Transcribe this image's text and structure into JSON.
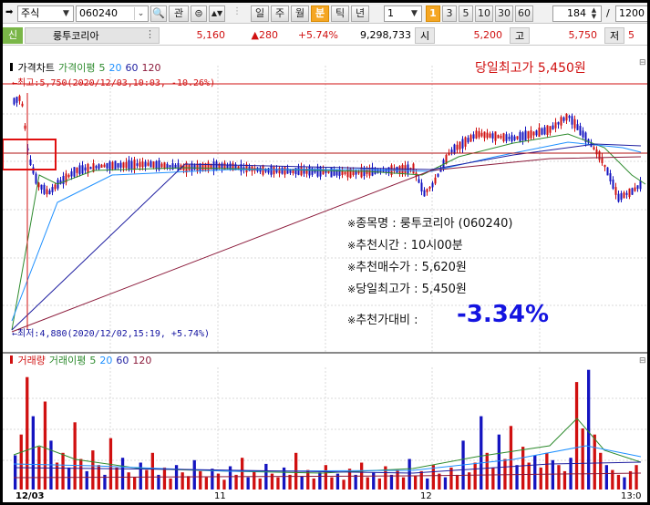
{
  "toolbar": {
    "market_label": "주식",
    "code_value": "060240",
    "search_label": "관",
    "period_buttons": [
      "일",
      "주",
      "월",
      "분",
      "틱",
      "년"
    ],
    "selected_period": "분",
    "interval_value": "1",
    "minute_buttons": [
      "1",
      "3",
      "5",
      "10",
      "30",
      "60"
    ],
    "selected_minute": "1",
    "count_value": "184",
    "slash": "/",
    "total_value": "1200"
  },
  "infobar": {
    "credit_badge": "신",
    "stock_name": "룽투코리아",
    "price": "5,160",
    "change": "▲280",
    "change_pct": "+5.74%",
    "volume": "9,298,733",
    "open_label": "시",
    "open_value": "5,200",
    "high_label": "고",
    "high_value": "5,750",
    "low_label": "저",
    "low_value": "5"
  },
  "price_chart": {
    "legend": [
      {
        "text": "가격차트",
        "color": "#000000"
      },
      {
        "text": "가격이평",
        "color": "#2e8b2e"
      },
      {
        "text": "5",
        "color": "#2e8b2e"
      },
      {
        "text": "20",
        "color": "#1e90ff"
      },
      {
        "text": "60",
        "color": "#1e1ea0"
      },
      {
        "text": "120",
        "color": "#8b1a3a"
      }
    ],
    "high_marker": "←최고:5,750(2020/12/03,10:03, -10.26%)",
    "low_marker": "←최저:4,880(2020/12/02,15:19, +5.74%)",
    "daily_high_banner": "당일최고가 5,450원",
    "bullet_mark": "※",
    "info_lines": [
      "종목명 : 룽투코리아 (060240)",
      "추천시간 : 10시00분",
      "추천매수가 : 5,620원",
      "당일최고가 : 5,450원",
      "추천가대비 :"
    ],
    "return_value": "-3.34%",
    "return_color": "#1414e0"
  },
  "volume_chart": {
    "legend": [
      {
        "text": "거래량",
        "color": "#d01010"
      },
      {
        "text": "거래이평",
        "color": "#2e8b2e"
      },
      {
        "text": "5",
        "color": "#2e8b2e"
      },
      {
        "text": "20",
        "color": "#1e90ff"
      },
      {
        "text": "60",
        "color": "#1e1ea0"
      },
      {
        "text": "120",
        "color": "#8b1a3a"
      }
    ]
  },
  "x_axis": {
    "labels": [
      "12/03",
      "11",
      "12",
      "13:0"
    ]
  },
  "chart_data": {
    "type": "candlestick",
    "price_high": 5750,
    "price_low": 4880,
    "volume_bars": [
      0.28,
      0.45,
      0.92,
      0.6,
      0.35,
      0.72,
      0.4,
      0.22,
      0.3,
      0.18,
      0.55,
      0.25,
      0.15,
      0.32,
      0.2,
      0.12,
      0.42,
      0.18,
      0.26,
      0.14,
      0.1,
      0.22,
      0.16,
      0.3,
      0.12,
      0.18,
      0.09,
      0.2,
      0.14,
      0.11,
      0.24,
      0.15,
      0.1,
      0.17,
      0.13,
      0.08,
      0.19,
      0.12,
      0.26,
      0.1,
      0.15,
      0.09,
      0.21,
      0.13,
      0.1,
      0.18,
      0.12,
      0.3,
      0.11,
      0.16,
      0.09,
      0.14,
      0.2,
      0.1,
      0.13,
      0.08,
      0.17,
      0.12,
      0.22,
      0.1,
      0.14,
      0.09,
      0.19,
      0.12,
      0.16,
      0.1,
      0.25,
      0.11,
      0.15,
      0.09,
      0.2,
      0.13,
      0.1,
      0.18,
      0.12,
      0.4,
      0.14,
      0.22,
      0.6,
      0.3,
      0.18,
      0.45,
      0.25,
      0.52,
      0.2,
      0.35,
      0.22,
      0.28,
      0.18,
      0.3,
      0.24,
      0.2,
      0.15,
      0.26,
      0.88,
      0.5,
      0.98,
      0.45,
      0.3,
      0.2,
      0.16,
      0.12,
      0.1,
      0.15,
      0.2
    ]
  }
}
